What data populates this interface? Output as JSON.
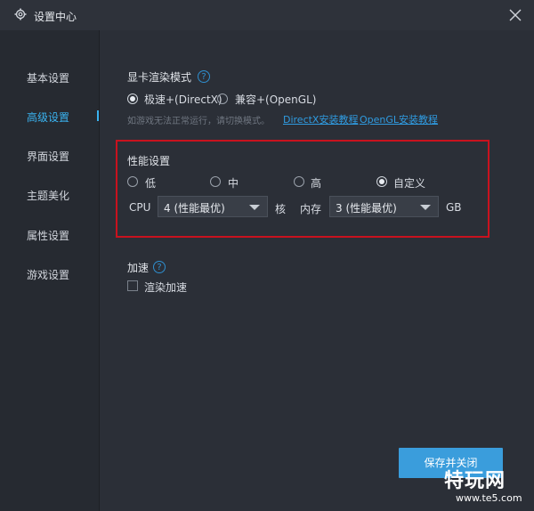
{
  "window": {
    "title": "设置中心"
  },
  "sidebar": {
    "items": [
      {
        "label": "基本设置"
      },
      {
        "label": "高级设置"
      },
      {
        "label": "界面设置"
      },
      {
        "label": "主题美化"
      },
      {
        "label": "属性设置"
      },
      {
        "label": "游戏设置"
      }
    ],
    "active_index": 1
  },
  "render_mode": {
    "title": "显卡渲染模式",
    "help": "?",
    "options": [
      {
        "label": "极速+(DirectX)",
        "checked": true
      },
      {
        "label": "兼容+(OpenGL)",
        "checked": false
      }
    ],
    "hint": "如游戏无法正常运行，请切换模式。",
    "links": [
      "DirectX安装教程",
      "OpenGL安装教程"
    ]
  },
  "performance": {
    "title": "性能设置",
    "options": [
      {
        "label": "低",
        "checked": false
      },
      {
        "label": "中",
        "checked": false
      },
      {
        "label": "高",
        "checked": false
      },
      {
        "label": "自定义",
        "checked": true
      }
    ],
    "cpu_label": "CPU",
    "cpu_value": "4 (性能最优)",
    "cpu_unit": "核",
    "mem_label": "内存",
    "mem_value": "3 (性能最优)",
    "mem_unit": "GB"
  },
  "accel": {
    "title": "加速",
    "help": "?",
    "checkbox_label": "渲染加速",
    "checked": false
  },
  "footer": {
    "save_label": "保存并关闭"
  },
  "watermark": {
    "main": "特玩网",
    "sub": "www.te5.com"
  },
  "colors": {
    "accent": "#3ab3f0",
    "button": "#3a9ddc",
    "highlight_box": "#c9121e"
  }
}
